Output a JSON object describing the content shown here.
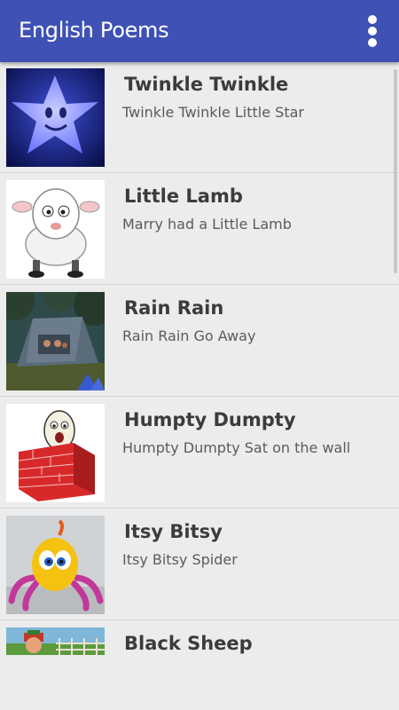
{
  "app": {
    "title": "English Poems",
    "overflow_icon": "more-vert-icon",
    "bar_color": "#3f51b5"
  },
  "poems": [
    {
      "title": "Twinkle Twinkle",
      "subtitle": "Twinkle Twinkle Little Star",
      "thumbnail": "star-character-image"
    },
    {
      "title": "Little Lamb",
      "subtitle": "Marry had a Little Lamb",
      "thumbnail": "lamb-character-image"
    },
    {
      "title": "Rain Rain",
      "subtitle": "Rain Rain Go Away",
      "thumbnail": "tent-in-rain-image"
    },
    {
      "title": "Humpty Dumpty",
      "subtitle": "Humpty Dumpty Sat on the wall",
      "thumbnail": "egg-on-wall-image"
    },
    {
      "title": "Itsy Bitsy",
      "subtitle": "Itsy Bitsy Spider",
      "thumbnail": "spider-character-image"
    },
    {
      "title": "Black Sheep",
      "subtitle": "",
      "thumbnail": "farm-scene-image"
    }
  ]
}
